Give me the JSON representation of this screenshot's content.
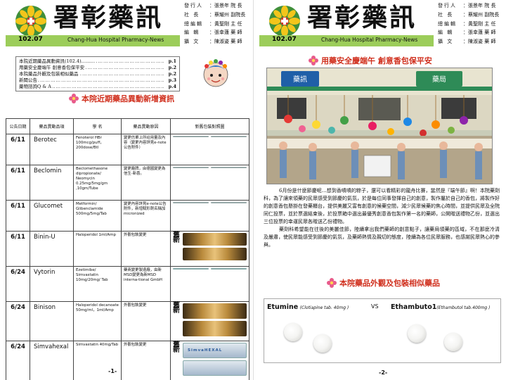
{
  "masthead": {
    "title": "署彰藥訊",
    "issue": "102.07",
    "subtitle": "Chang-Hua Hospital Pharmacy-News"
  },
  "staff": [
    {
      "role": "發行人",
      "name": "：張景年 院 長"
    },
    {
      "role": "社 長",
      "name": "：蔡耀州 副院長"
    },
    {
      "role": "總編輯",
      "name": "：黃聖剛 主 任"
    },
    {
      "role": "編 輯",
      "name": "：張幸蓮 藥 師"
    },
    {
      "role": "攝 文",
      "name": "：陳淑姿 藥 師"
    }
  ],
  "toc": [
    {
      "title": "本院近期藥品異動資訊(102.4)………",
      "page": "p.1"
    },
    {
      "title": "用藥安全慶端午 創意香包保平安",
      "page": "p.2"
    },
    {
      "title": "本院藥品外觀及包裝相似藥品",
      "page": "p.2"
    },
    {
      "title": "新聞公告",
      "page": "p.3"
    },
    {
      "title": "藥物諮詢Q & A",
      "page": "p.4"
    }
  ],
  "page1": {
    "section_title": "本院近期藥品異動新增資訊",
    "table_headers": [
      "公告日期",
      "藥品異動品項",
      "學 名",
      "藥品異動原因",
      "新舊包裝對照圖"
    ],
    "rows": [
      {
        "date": "6/11",
        "name": "Berotec",
        "generic": "Fenoterol HBr 100mcg/puff，200dose/Btl",
        "reason": "變更仿單上所註用量及內容（變更內容詳見e-note公告附件）",
        "media": "box",
        "pack_label": ""
      },
      {
        "date": "6/11",
        "name": "Beclomin",
        "generic": "Beclomethasone dipropionate/ Neomycin 0.25mg/5mg/gm ,10gm/Tube",
        "reason": "變更廠牌，由德國變更為信生-新喜。",
        "media": "box",
        "pack_label": ""
      },
      {
        "date": "6/11",
        "name": "Glucomet",
        "generic": "Metformin/ Glibenclamide 500mg/5mg/Tab",
        "reason": "變更內容詳見e-note公告附件，新增賦形劑名稱加micronized",
        "media": "box",
        "pack_label": ""
      },
      {
        "date": "6/11",
        "name": "Binin-U",
        "generic": "Haloperidol 1ml/Amp",
        "reason": "外觀包裝變更",
        "media": "oldnew",
        "pack_label": ""
      },
      {
        "date": "6/24",
        "name": "Vytorin",
        "generic": "Ezetimibe/ Simvastatin 10mg/20mg/ Tab",
        "reason": "藥商變更製造廠，由新MSD變更為新MSD interna-tional GmbH",
        "media": "blister",
        "pack_label": ""
      },
      {
        "date": "6/24",
        "name": "Binison",
        "generic": "Haloperidol decanoate 50mg/ml，1ml/Amp",
        "reason": "外觀包裝變更",
        "media": "oldnew",
        "pack_label": ""
      },
      {
        "date": "6/24",
        "name": "Simvahexal",
        "generic": "Simvastatin 40mg/Tab",
        "reason": "外觀包裝變更",
        "media": "oldnew",
        "pack_label": "SimvaHEXAL"
      }
    ],
    "old_label": "舊",
    "new_label": "新",
    "page_number": "-1-"
  },
  "page2": {
    "section_title": "用藥安全慶端午 創意香包保平安",
    "photo_sign_1": "藥訊",
    "photo_sign_2": "藥局",
    "body": [
      "6月份是什麼節慶呢…想到香噴噴的粽子，還可以看精彩的龍舟比賽，當然是『端午節』啊！本院藥劑科，為了讓來領藥的民眾感受到節慶的氣氛，於是每位同事發揮自己的創意，製作屬於自己的香包，將製作好的創意香包懸掛在發藥櫃台，提供美麗又富有創意的候藥空間，減少民眾候藥的焦心時間，並提供民眾及全院同仁投票，並於票選結束後，於投票箱中選出最優秀創意香包製作第一名的藥師，公開贈送禮物乙份，並選出三位投票的幸運民眾各贈送乙份禮物。",
      "藥劑科希望能在往後的美麗佳節，陸續拿出我們藥師的創意點子，讓藥局領藥的區域，不在那麼冷清及嚴肅，使民眾能感受到節慶的氣氛，及藥師熱情及親切的態度，陸續為各位民眾服務，也感謝民眾熱心的參與。"
    ],
    "section_title_2": "本院藥品外觀及包裝相似藥品",
    "compare_left_brand": "Etumine",
    "compare_left_note": "(Clotiapine tab. 40mg )",
    "compare_vs": "VS",
    "compare_right_brand": "Ethambuto1",
    "compare_right_note": "(Ethambutol tab.400mg )",
    "page_number": "-2-"
  }
}
